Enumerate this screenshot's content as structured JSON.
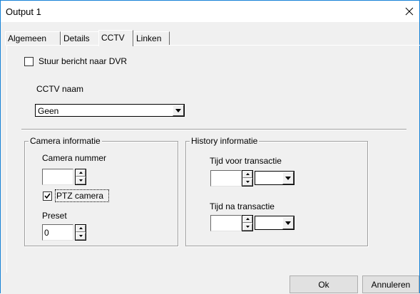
{
  "window": {
    "title": "Output 1"
  },
  "tabs": [
    {
      "label": "Algemeen"
    },
    {
      "label": "Details"
    },
    {
      "label": "CCTV"
    },
    {
      "label": "Linken"
    }
  ],
  "active_tab": "CCTV",
  "dvr": {
    "label": "Stuur bericht naar DVR",
    "checked": false
  },
  "cctv_name": {
    "label": "CCTV naam",
    "value": "Geen"
  },
  "camera_group": {
    "legend": "Camera informatie",
    "camera_number_label": "Camera nummer",
    "camera_number_value": "",
    "ptz_label": "PTZ camera",
    "ptz_checked": true,
    "preset_label": "Preset",
    "preset_value": "0"
  },
  "history_group": {
    "legend": "History informatie",
    "before_label": "Tijd voor transactie",
    "before_value": "",
    "before_unit": "",
    "after_label": "Tijd na transactie",
    "after_value": "",
    "after_unit": ""
  },
  "buttons": {
    "ok": "Ok",
    "cancel": "Annuleren"
  },
  "icons": {
    "close": "close-icon",
    "dropdown": "chevron-down-icon",
    "spin_up": "spin-up-icon",
    "spin_down": "spin-down-icon",
    "check": "check-icon"
  }
}
